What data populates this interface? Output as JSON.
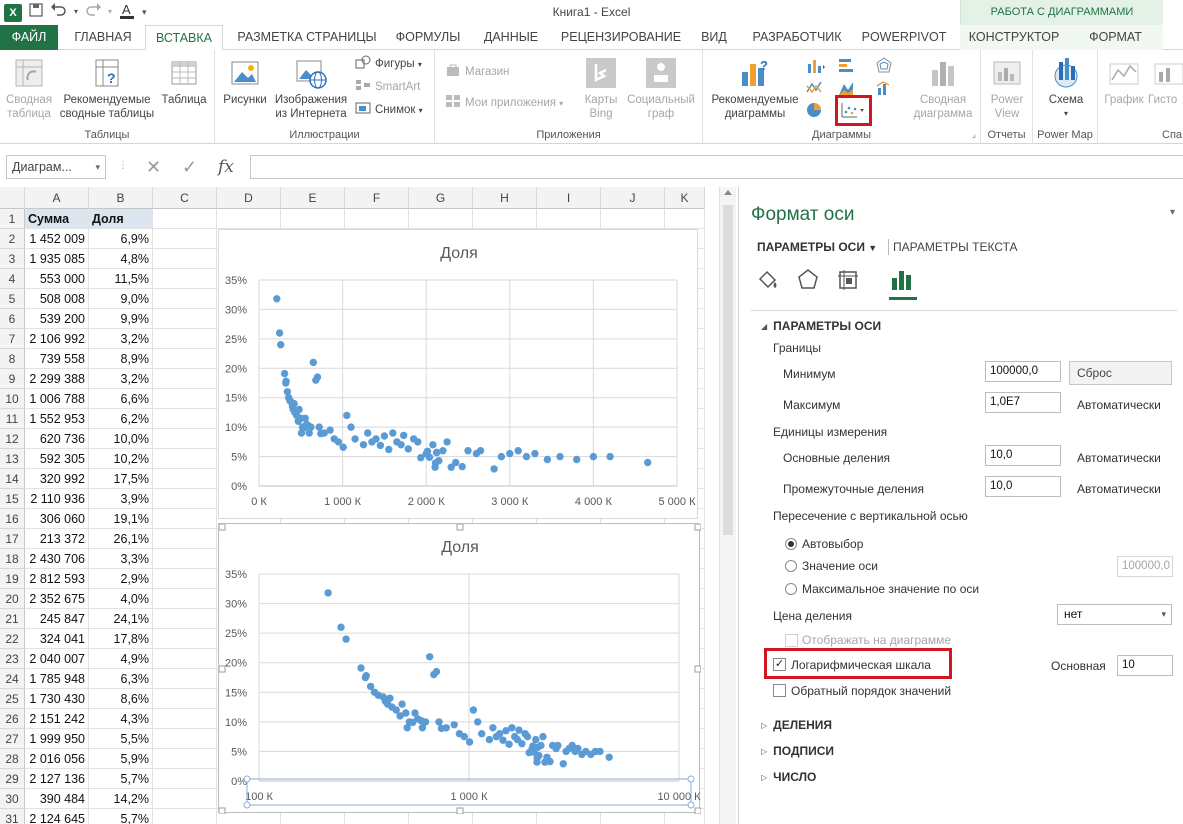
{
  "window": {
    "title": "Книга1 - Excel",
    "context_group": "РАБОТА С ДИАГРАММАМИ"
  },
  "tabs": [
    {
      "label": "ФАЙЛ"
    },
    {
      "label": "ГЛАВНАЯ"
    },
    {
      "label": "ВСТАВКА"
    },
    {
      "label": "РАЗМЕТКА СТРАНИЦЫ"
    },
    {
      "label": "ФОРМУЛЫ"
    },
    {
      "label": "ДАННЫЕ"
    },
    {
      "label": "РЕЦЕНЗИРОВАНИЕ"
    },
    {
      "label": "ВИД"
    },
    {
      "label": "РАЗРАБОТЧИК"
    },
    {
      "label": "POWERPIVOT"
    },
    {
      "label": "КОНСТРУКТОР"
    },
    {
      "label": "ФОРМАТ"
    }
  ],
  "ribbon": {
    "tables": {
      "label": "Таблицы",
      "pivot_line1": "Сводная",
      "pivot_line2": "таблица",
      "recommended_line1": "Рекомендуемые",
      "recommended_line2": "сводные таблицы",
      "table": "Таблица"
    },
    "illustrations": {
      "label": "Иллюстрации",
      "pictures": "Рисунки",
      "online_line1": "Изображения",
      "online_line2": "из Интернета",
      "shapes": "Фигуры",
      "smartart": "SmartArt",
      "screenshot": "Снимок"
    },
    "apps": {
      "label": "Приложения",
      "store": "Магазин",
      "my_apps": "Мои приложения",
      "bing_line1": "Карты",
      "bing_line2": "Bing",
      "social_line1": "Социальный",
      "social_line2": "граф"
    },
    "charts": {
      "label": "Диаграммы",
      "recommended_line1": "Рекомендуемые",
      "recommended_line2": "диаграммы",
      "pivot_line1": "Сводная",
      "pivot_line2": "диаграмма"
    },
    "reports": {
      "label": "Отчеты",
      "power_view_line1": "Power",
      "power_view_line2": "View"
    },
    "powermap": {
      "label": "Power Map",
      "map": "Схема"
    },
    "sparklines": {
      "label": "Спа",
      "line": "График",
      "hist": "Гисто"
    }
  },
  "formula_bar": {
    "name_box": "Диаграм...",
    "fx": "fx",
    "value": ""
  },
  "grid": {
    "columns": [
      "A",
      "B",
      "C",
      "D",
      "E",
      "F",
      "G",
      "H",
      "I",
      "J",
      "K"
    ],
    "header_row": [
      "Сумма",
      "Доля"
    ],
    "rows": [
      [
        "1 452 009",
        "6,9%"
      ],
      [
        "1 935 085",
        "4,8%"
      ],
      [
        "553 000",
        "11,5%"
      ],
      [
        "508 008",
        "9,0%"
      ],
      [
        "539 200",
        "9,9%"
      ],
      [
        "2 106 992",
        "3,2%"
      ],
      [
        "739 558",
        "8,9%"
      ],
      [
        "2 299 388",
        "3,2%"
      ],
      [
        "1 006 788",
        "6,6%"
      ],
      [
        "1 552 953",
        "6,2%"
      ],
      [
        "620 736",
        "10,0%"
      ],
      [
        "592 305",
        "10,2%"
      ],
      [
        "320 992",
        "17,5%"
      ],
      [
        "2 110 936",
        "3,9%"
      ],
      [
        "306 060",
        "19,1%"
      ],
      [
        "213 372",
        "26,1%"
      ],
      [
        "2 430 706",
        "3,3%"
      ],
      [
        "2 812 593",
        "2,9%"
      ],
      [
        "2 352 675",
        "4,0%"
      ],
      [
        "245 847",
        "24,1%"
      ],
      [
        "324 041",
        "17,8%"
      ],
      [
        "2 040 007",
        "4,9%"
      ],
      [
        "1 785 948",
        "6,3%"
      ],
      [
        "1 730 430",
        "8,6%"
      ],
      [
        "2 151 242",
        "4,3%"
      ],
      [
        "1 999 950",
        "5,5%"
      ],
      [
        "2 016 056",
        "5,9%"
      ],
      [
        "2 127 136",
        "5,7%"
      ],
      [
        "390 484",
        "14,2%"
      ],
      [
        "2 124 645",
        "5,7%"
      ]
    ]
  },
  "chart_data": [
    {
      "type": "scatter",
      "title": "Доля",
      "x_scale": "linear",
      "xlim": [
        0,
        5000000
      ],
      "ylim": [
        0,
        0.35
      ],
      "x_ticks": [
        "0 К",
        "1 000 К",
        "2 000 К",
        "3 000 К",
        "4 000 К",
        "5 000 К"
      ],
      "y_ticks": [
        "0%",
        "5%",
        "10%",
        "15%",
        "20%",
        "25%",
        "30%",
        "35%"
      ],
      "grid": true,
      "color": "#5b9bd5",
      "points": [
        [
          213372,
          0.318
        ],
        [
          245847,
          0.26
        ],
        [
          260000,
          0.24
        ],
        [
          306060,
          0.191
        ],
        [
          320992,
          0.175
        ],
        [
          324041,
          0.178
        ],
        [
          340000,
          0.16
        ],
        [
          355000,
          0.15
        ],
        [
          370000,
          0.145
        ],
        [
          390484,
          0.142
        ],
        [
          400000,
          0.135
        ],
        [
          410000,
          0.13
        ],
        [
          420000,
          0.14
        ],
        [
          430000,
          0.125
        ],
        [
          450000,
          0.12
        ],
        [
          470000,
          0.11
        ],
        [
          480000,
          0.13
        ],
        [
          500000,
          0.115
        ],
        [
          508008,
          0.09
        ],
        [
          520000,
          0.1
        ],
        [
          539200,
          0.099
        ],
        [
          553000,
          0.115
        ],
        [
          570000,
          0.105
        ],
        [
          592305,
          0.102
        ],
        [
          600000,
          0.09
        ],
        [
          620736,
          0.1
        ],
        [
          650000,
          0.21
        ],
        [
          680000,
          0.18
        ],
        [
          700000,
          0.185
        ],
        [
          720000,
          0.1
        ],
        [
          739558,
          0.089
        ],
        [
          780000,
          0.09
        ],
        [
          850000,
          0.095
        ],
        [
          900000,
          0.08
        ],
        [
          950000,
          0.075
        ],
        [
          1006788,
          0.066
        ],
        [
          1050000,
          0.12
        ],
        [
          1100000,
          0.1
        ],
        [
          1150000,
          0.08
        ],
        [
          1250000,
          0.07
        ],
        [
          1300000,
          0.09
        ],
        [
          1350000,
          0.075
        ],
        [
          1400000,
          0.08
        ],
        [
          1452009,
          0.069
        ],
        [
          1500000,
          0.085
        ],
        [
          1552953,
          0.062
        ],
        [
          1600000,
          0.09
        ],
        [
          1650000,
          0.075
        ],
        [
          1700000,
          0.07
        ],
        [
          1730430,
          0.086
        ],
        [
          1785948,
          0.063
        ],
        [
          1850000,
          0.08
        ],
        [
          1900000,
          0.075
        ],
        [
          1935085,
          0.048
        ],
        [
          1999950,
          0.055
        ],
        [
          2016056,
          0.059
        ],
        [
          2040007,
          0.049
        ],
        [
          2080000,
          0.07
        ],
        [
          2106992,
          0.032
        ],
        [
          2110936,
          0.039
        ],
        [
          2124645,
          0.057
        ],
        [
          2127136,
          0.057
        ],
        [
          2151242,
          0.043
        ],
        [
          2200000,
          0.06
        ],
        [
          2250000,
          0.075
        ],
        [
          2299388,
          0.032
        ],
        [
          2352675,
          0.04
        ],
        [
          2430706,
          0.033
        ],
        [
          2500000,
          0.06
        ],
        [
          2600000,
          0.055
        ],
        [
          2650000,
          0.06
        ],
        [
          2812593,
          0.029
        ],
        [
          2900000,
          0.05
        ],
        [
          3000000,
          0.055
        ],
        [
          3100000,
          0.06
        ],
        [
          3200000,
          0.05
        ],
        [
          3300000,
          0.055
        ],
        [
          3450000,
          0.045
        ],
        [
          3600000,
          0.05
        ],
        [
          3800000,
          0.045
        ],
        [
          4000000,
          0.05
        ],
        [
          4200000,
          0.05
        ],
        [
          4650000,
          0.04
        ]
      ]
    },
    {
      "type": "scatter",
      "title": "Доля",
      "x_scale": "log",
      "xlim": [
        100000,
        10000000
      ],
      "ylim": [
        0,
        0.35
      ],
      "x_ticks": [
        "100 К",
        "1 000 К",
        "10 000 К"
      ],
      "y_ticks": [
        "0%",
        "5%",
        "10%",
        "15%",
        "20%",
        "25%",
        "30%",
        "35%"
      ],
      "grid": true,
      "color": "#5b9bd5",
      "points": [
        [
          213372,
          0.318
        ],
        [
          245847,
          0.26
        ],
        [
          260000,
          0.24
        ],
        [
          306060,
          0.191
        ],
        [
          320992,
          0.175
        ],
        [
          324041,
          0.178
        ],
        [
          340000,
          0.16
        ],
        [
          355000,
          0.15
        ],
        [
          370000,
          0.145
        ],
        [
          390484,
          0.142
        ],
        [
          400000,
          0.135
        ],
        [
          410000,
          0.13
        ],
        [
          420000,
          0.14
        ],
        [
          430000,
          0.125
        ],
        [
          450000,
          0.12
        ],
        [
          470000,
          0.11
        ],
        [
          480000,
          0.13
        ],
        [
          500000,
          0.115
        ],
        [
          508008,
          0.09
        ],
        [
          520000,
          0.1
        ],
        [
          539200,
          0.099
        ],
        [
          553000,
          0.115
        ],
        [
          570000,
          0.105
        ],
        [
          592305,
          0.102
        ],
        [
          600000,
          0.09
        ],
        [
          620736,
          0.1
        ],
        [
          650000,
          0.21
        ],
        [
          680000,
          0.18
        ],
        [
          700000,
          0.185
        ],
        [
          720000,
          0.1
        ],
        [
          739558,
          0.089
        ],
        [
          780000,
          0.09
        ],
        [
          850000,
          0.095
        ],
        [
          900000,
          0.08
        ],
        [
          950000,
          0.075
        ],
        [
          1006788,
          0.066
        ],
        [
          1050000,
          0.12
        ],
        [
          1100000,
          0.1
        ],
        [
          1150000,
          0.08
        ],
        [
          1250000,
          0.07
        ],
        [
          1300000,
          0.09
        ],
        [
          1350000,
          0.075
        ],
        [
          1400000,
          0.08
        ],
        [
          1452009,
          0.069
        ],
        [
          1500000,
          0.085
        ],
        [
          1552953,
          0.062
        ],
        [
          1600000,
          0.09
        ],
        [
          1650000,
          0.075
        ],
        [
          1700000,
          0.07
        ],
        [
          1730430,
          0.086
        ],
        [
          1785948,
          0.063
        ],
        [
          1850000,
          0.08
        ],
        [
          1900000,
          0.075
        ],
        [
          1935085,
          0.048
        ],
        [
          1999950,
          0.055
        ],
        [
          2016056,
          0.059
        ],
        [
          2040007,
          0.049
        ],
        [
          2080000,
          0.07
        ],
        [
          2106992,
          0.032
        ],
        [
          2110936,
          0.039
        ],
        [
          2124645,
          0.057
        ],
        [
          2127136,
          0.057
        ],
        [
          2151242,
          0.043
        ],
        [
          2200000,
          0.06
        ],
        [
          2250000,
          0.075
        ],
        [
          2299388,
          0.032
        ],
        [
          2352675,
          0.04
        ],
        [
          2430706,
          0.033
        ],
        [
          2500000,
          0.06
        ],
        [
          2600000,
          0.055
        ],
        [
          2650000,
          0.06
        ],
        [
          2812593,
          0.029
        ],
        [
          2900000,
          0.05
        ],
        [
          3000000,
          0.055
        ],
        [
          3100000,
          0.06
        ],
        [
          3200000,
          0.05
        ],
        [
          3300000,
          0.055
        ],
        [
          3450000,
          0.045
        ],
        [
          3600000,
          0.05
        ],
        [
          3800000,
          0.045
        ],
        [
          4000000,
          0.05
        ],
        [
          4200000,
          0.05
        ],
        [
          4650000,
          0.04
        ]
      ]
    }
  ],
  "format_pane": {
    "title": "Формат оси",
    "tab_axis": "ПАРАМЕТРЫ ОСИ",
    "tab_text": "ПАРАМЕТРЫ ТЕКСТА",
    "section_axis": "ПАРАМЕТРЫ ОСИ",
    "bounds_label": "Границы",
    "min_label": "Минимум",
    "min_value": "100000,0",
    "reset_label": "Сброс",
    "max_label": "Максимум",
    "max_value": "1,0E7",
    "max_mode": "Автоматически",
    "units_label": "Единицы измерения",
    "major_label": "Основные деления",
    "major_value": "10,0",
    "major_mode": "Автоматически",
    "minor_label": "Промежуточные деления",
    "minor_value": "10,0",
    "minor_mode": "Автоматически",
    "crosses_label": "Пересечение с вертикальной осью",
    "crosses_auto": "Автовыбор",
    "crosses_value": "Значение оси",
    "crosses_value_input": "100000,0",
    "crosses_max": "Максимальное значение по оси",
    "display_units_label": "Цена деления",
    "display_units_value": "нет",
    "show_on_chart": "Отображать на диаграмме",
    "log_scale": "Логарифмическая шкала",
    "log_scale_checked": true,
    "base_label": "Основная",
    "base_value": "10",
    "reverse_order": "Обратный порядок значений",
    "section_ticks": "ДЕЛЕНИЯ",
    "section_labels": "ПОДПИСИ",
    "section_number": "ЧИСЛО"
  }
}
